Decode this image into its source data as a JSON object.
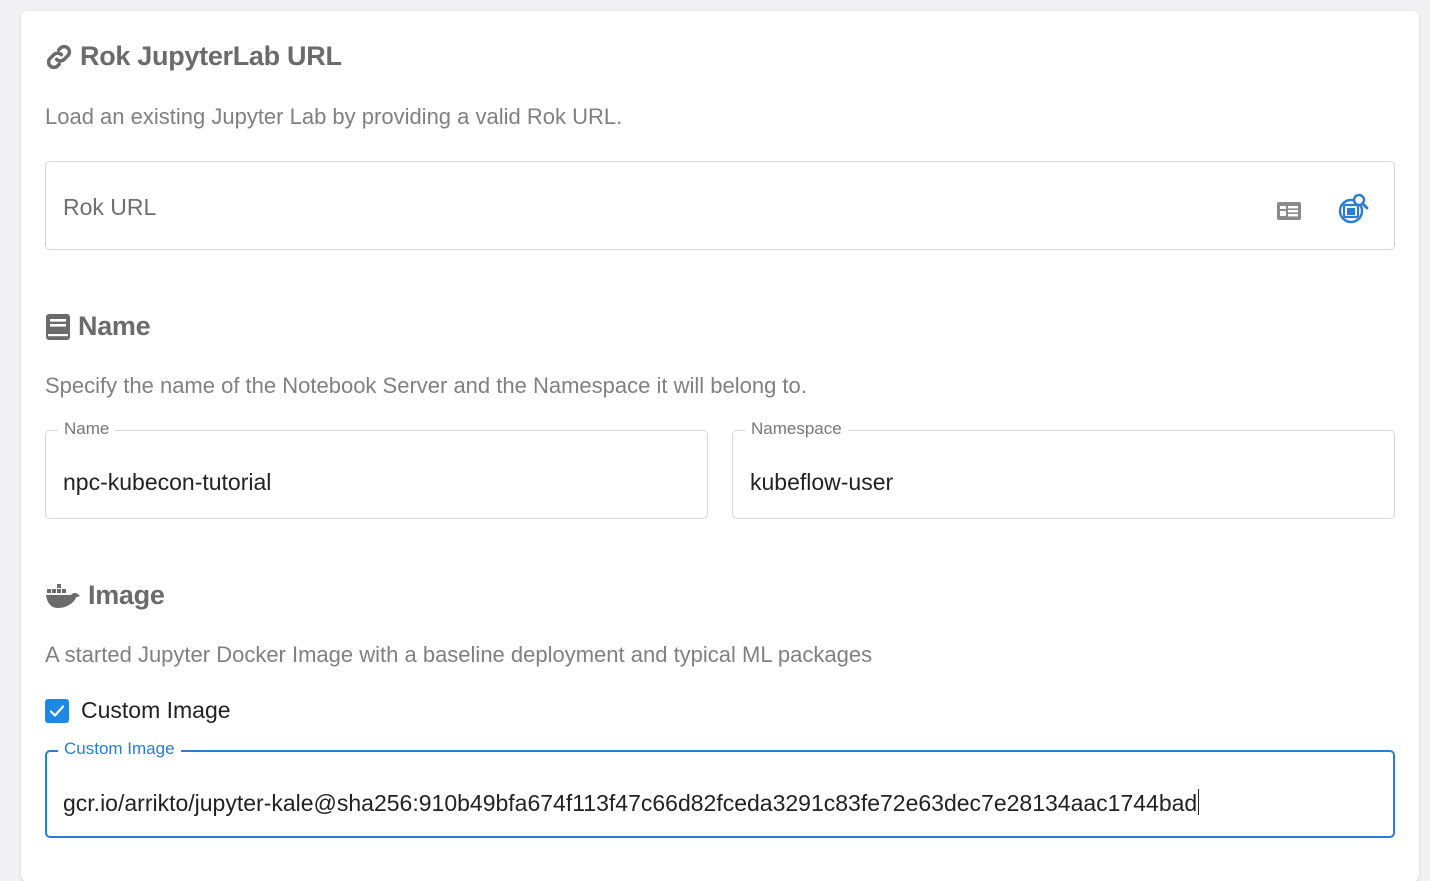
{
  "rok_section": {
    "title": "Rok JupyterLab URL",
    "title_icon": "link-icon",
    "description": "Load an existing Jupyter Lab by providing a valid Rok URL.",
    "url_input": {
      "placeholder": "Rok URL",
      "value": ""
    },
    "buttons": [
      {
        "icon": "id-card-icon"
      },
      {
        "icon": "rok-search-icon"
      }
    ]
  },
  "name_section": {
    "title": "Name",
    "title_icon": "book-icon",
    "description": "Specify the name of the Notebook Server and the Namespace it will belong to.",
    "name_field": {
      "label": "Name",
      "value": "npc-kubecon-tutorial"
    },
    "namespace_field": {
      "label": "Namespace",
      "value": "kubeflow-user"
    }
  },
  "image_section": {
    "title": "Image",
    "title_icon": "docker-icon",
    "description": "A started Jupyter Docker Image with a baseline deployment and typical ML packages",
    "custom_image_checkbox": {
      "label": "Custom Image",
      "checked": true
    },
    "custom_image_field": {
      "label": "Custom Image",
      "value": "gcr.io/arrikto/jupyter-kale@sha256:910b49bfa674f113f47c66d82fceda3291c83fe72e63dec7e28134aac1744bad"
    }
  },
  "colors": {
    "accent": "#1e88e5",
    "focus_border": "#2a7dd0",
    "title": "#6b6b6b",
    "description": "#808080"
  }
}
